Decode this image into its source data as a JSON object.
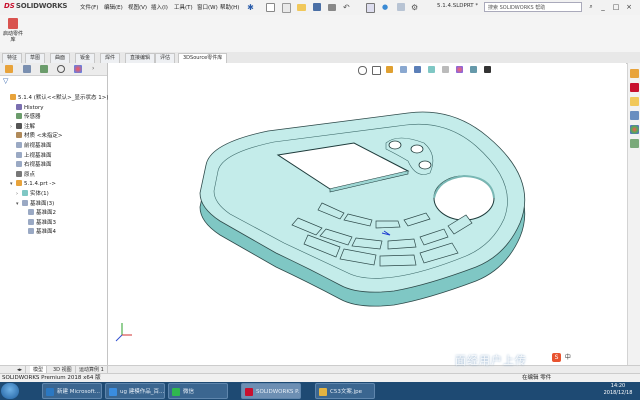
{
  "titlebar": {
    "logo_ds": "DS",
    "logo_text": "SOLIDWORKS",
    "menus": [
      "文件(F)",
      "编辑(E)",
      "视图(V)",
      "插入(I)",
      "工具(T)",
      "窗口(W)",
      "帮助(H)"
    ],
    "doc_title": "5.1.4.SLDPRT *",
    "search_placeholder": "搜索 SOLIDWORKS 帮助",
    "win_min": "_",
    "win_max": "□",
    "win_close": "×"
  },
  "command": {
    "button_label": "启动零件库"
  },
  "tabs": [
    "特征",
    "草图",
    "曲面",
    "钣金",
    "焊件",
    "直接编辑",
    "评估",
    "3DSource零件库"
  ],
  "active_tab": "3DSource零件库",
  "tree": {
    "filter_icon": "funnel-icon",
    "rows": [
      {
        "label": "5.1.4 (默认<<默认>_显示状态 1>)",
        "indent": 0,
        "exp": ""
      },
      {
        "label": "History",
        "indent": 1,
        "exp": ""
      },
      {
        "label": "传感器",
        "indent": 1,
        "exp": ""
      },
      {
        "label": "注解",
        "indent": 1,
        "exp": "›"
      },
      {
        "label": "材质 <未指定>",
        "indent": 1,
        "exp": ""
      },
      {
        "label": "前视基准面",
        "indent": 1,
        "exp": ""
      },
      {
        "label": "上视基准面",
        "indent": 1,
        "exp": ""
      },
      {
        "label": "右视基准面",
        "indent": 1,
        "exp": ""
      },
      {
        "label": "原点",
        "indent": 1,
        "exp": ""
      },
      {
        "label": "5.1.4.prt ->",
        "indent": 1,
        "exp": "▾"
      },
      {
        "label": "实体(1)",
        "indent": 2,
        "exp": "›"
      },
      {
        "label": "基准面(3)",
        "indent": 2,
        "exp": "▾"
      },
      {
        "label": "基准面2",
        "indent": 3,
        "exp": ""
      },
      {
        "label": "基准面3",
        "indent": 3,
        "exp": ""
      },
      {
        "label": "基准面4",
        "indent": 3,
        "exp": ""
      }
    ]
  },
  "model_tabs": [
    "模型",
    "3D 视图",
    "运动算例 1"
  ],
  "status": {
    "left": "SOLIDWORKS Premium 2018 x64 版",
    "right": "在编辑 零件"
  },
  "taskbar": {
    "tasks": [
      {
        "label": "新建 Microsoft...",
        "color": "#2b78c2"
      },
      {
        "label": "ug 建模作品_百...",
        "color": "#3a8de0"
      },
      {
        "label": "微信",
        "color": "#2fb84f"
      },
      {
        "label": "SOLIDWORKS P...",
        "color": "#c8102e"
      },
      {
        "label": "C53文案.jpe",
        "color": "#e3b341"
      }
    ],
    "active_task": 3,
    "time": "14:20",
    "date": "2018/12/18"
  },
  "ime": {
    "logo": "S",
    "lang": "中"
  },
  "watermark": "面经用户上传",
  "colors": {
    "model_top": "#c4ecea",
    "model_side": "#7fc7c4",
    "model_edge": "#2e4a4a",
    "accent": "#2a5caa"
  }
}
